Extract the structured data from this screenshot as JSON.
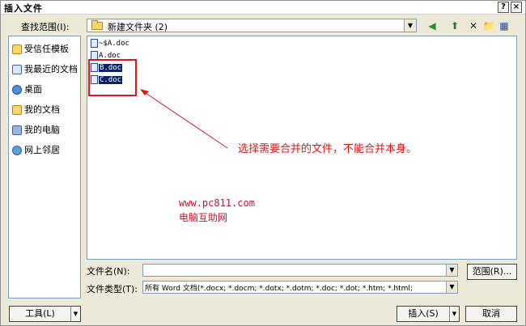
{
  "window": {
    "title": "插入文件",
    "help": "?",
    "close": "×"
  },
  "lookin": {
    "label": "查找范围(I):",
    "value": "新建文件夹 (2)"
  },
  "toolbar": {
    "back": "◀",
    "up": "⬆",
    "delete": "✕",
    "new_folder": "📁",
    "views": "▦"
  },
  "places": [
    {
      "label": "受信任模板",
      "icon": "folder-icon"
    },
    {
      "label": "我最近的文档",
      "icon": "recent-documents-icon"
    },
    {
      "label": "桌面",
      "icon": "desktop-icon"
    },
    {
      "label": "我的文档",
      "icon": "my-documents-icon"
    },
    {
      "label": "我的电脑",
      "icon": "my-computer-icon"
    },
    {
      "label": "网上邻居",
      "icon": "network-places-icon"
    }
  ],
  "files": [
    {
      "name": "~$A.doc",
      "selected": false
    },
    {
      "name": "A.doc",
      "selected": false
    },
    {
      "name": "B.doc",
      "selected": true
    },
    {
      "name": "C.doc",
      "selected": true
    }
  ],
  "annotation": {
    "note": "选择需要合并的文件，不能合并本身。"
  },
  "watermark": {
    "url": "www.pc811.com",
    "name": "电脑互助网"
  },
  "filename": {
    "label": "文件名(N):",
    "value": ""
  },
  "filetype": {
    "label": "文件类型(T):",
    "value": "所有 Word 文档(*.docx; *.docm; *.dotx; *.dotm; *.doc; *.dot; *.htm; *.html;"
  },
  "buttons": {
    "range": "范围(R)...",
    "tools": "工具(L)",
    "insert": "插入(S)",
    "cancel": "取消"
  },
  "colors": {
    "annotation": "#e01818",
    "selection": "#0a246a",
    "watermark": "#c8162c"
  }
}
